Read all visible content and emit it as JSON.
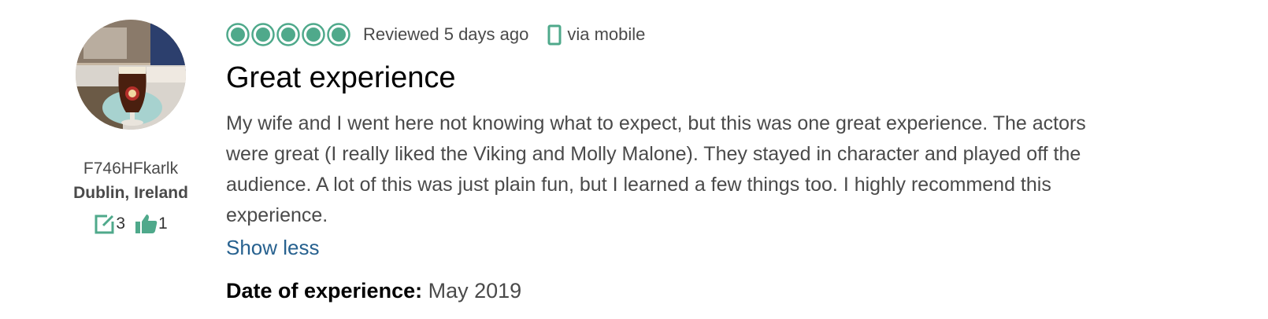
{
  "reviewer": {
    "username": "F746HFkarlk",
    "location": "Dublin, Ireland",
    "review_count": "3",
    "helpful_votes": "1"
  },
  "review": {
    "rating": 5,
    "rating_max": 5,
    "reviewed_text": "Reviewed 5 days ago",
    "via_text": "via mobile",
    "title": "Great experience",
    "body": "My wife and I went here not knowing what to expect, but this was one great experience. The actors were great (I really liked the Viking and Molly Malone). They stayed in character and played off the audience. A lot of this was just plain fun, but I learned a few things too. I highly recommend this experience.",
    "show_less_label": "Show less",
    "date_label": "Date of experience:",
    "date_value": "May 2019"
  },
  "colors": {
    "rating_green": "#4fa98b",
    "link_blue": "#27618f",
    "text_gray": "#4a4a4a"
  },
  "icons": {
    "rating": "bubble-rating-icon",
    "device": "mobile-phone-icon",
    "reviews": "review-count-icon",
    "helpful": "thumbs-up-icon"
  }
}
